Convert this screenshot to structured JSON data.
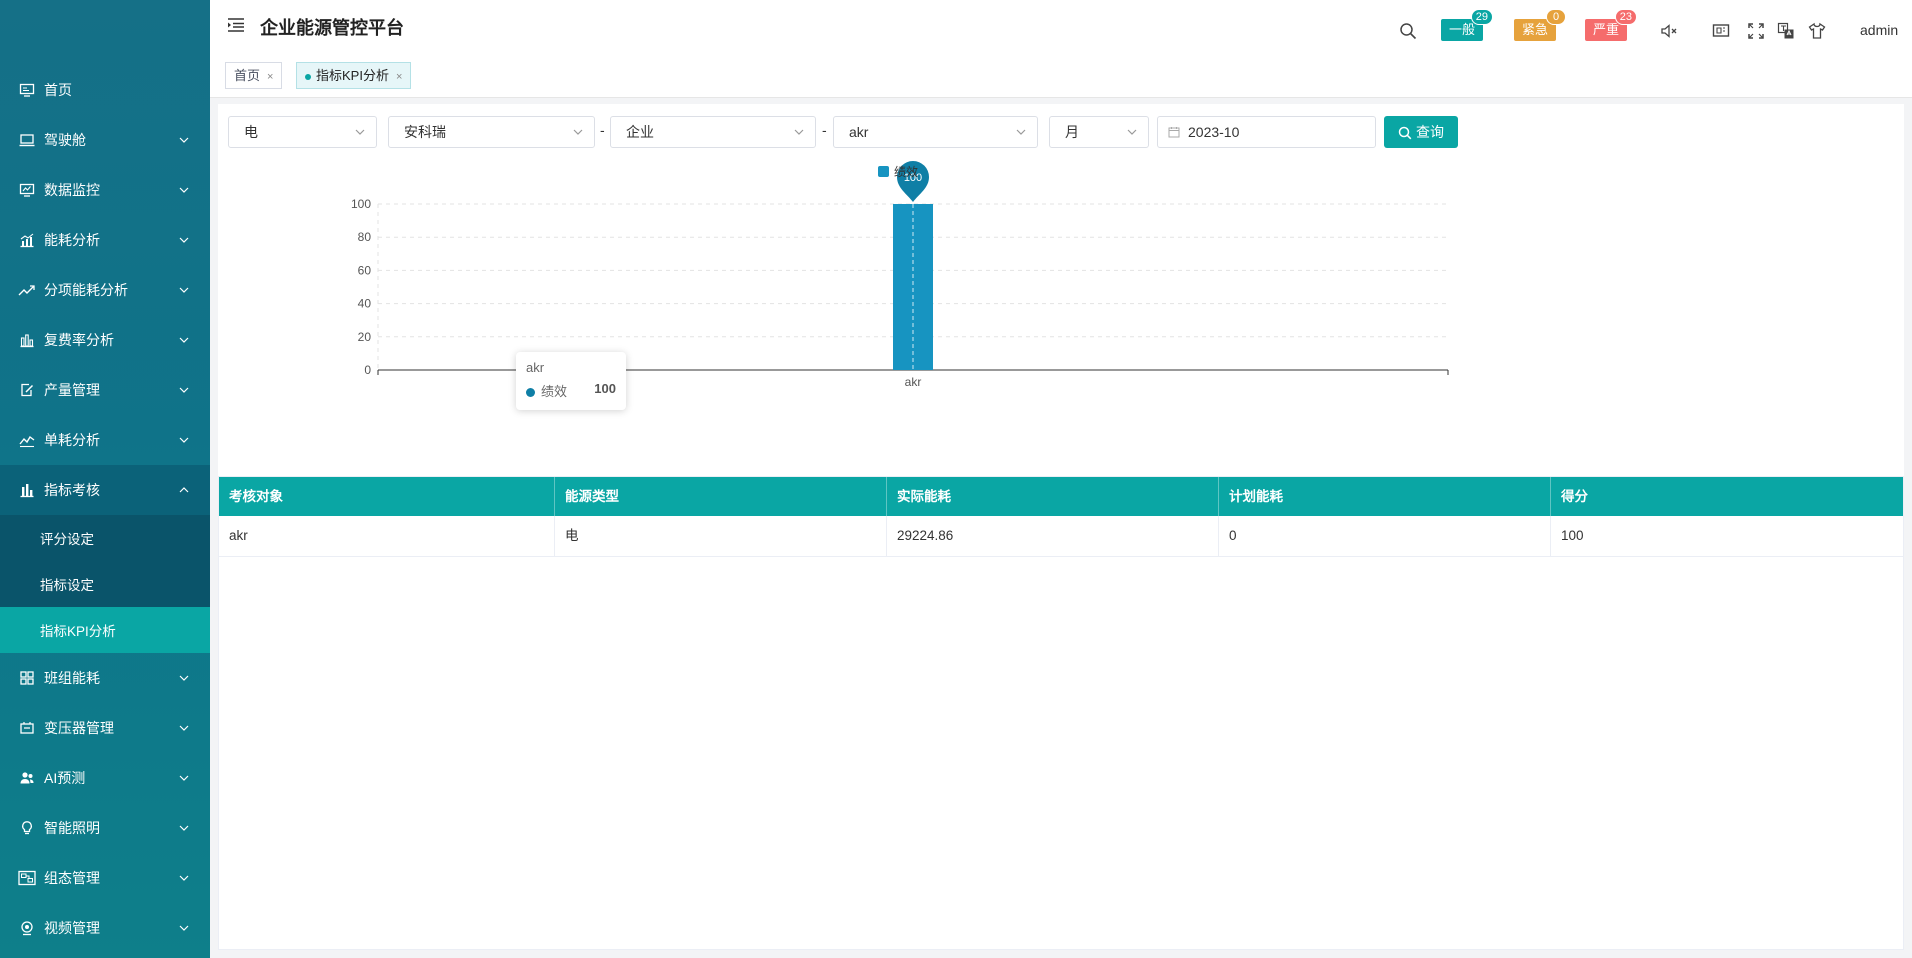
{
  "header": {
    "title": "企业能源管控平台",
    "user": "admin"
  },
  "alarms": [
    {
      "label": "一般",
      "count": "29",
      "color": "#0aa6a4"
    },
    {
      "label": "紧急",
      "count": "0",
      "color": "#e6a23c"
    },
    {
      "label": "严重",
      "count": "23",
      "color": "#f56c6c"
    }
  ],
  "sidebar": {
    "items": [
      {
        "label": "首页"
      },
      {
        "label": "驾驶舱"
      },
      {
        "label": "数据监控"
      },
      {
        "label": "能耗分析"
      },
      {
        "label": "分项能耗分析"
      },
      {
        "label": "复费率分析"
      },
      {
        "label": "产量管理"
      },
      {
        "label": "单耗分析"
      },
      {
        "label": "指标考核",
        "children": [
          {
            "label": "评分设定"
          },
          {
            "label": "指标设定"
          },
          {
            "label": "指标KPI分析"
          }
        ]
      },
      {
        "label": "班组能耗"
      },
      {
        "label": "变压器管理"
      },
      {
        "label": "AI预测"
      },
      {
        "label": "智能照明"
      },
      {
        "label": "组态管理"
      },
      {
        "label": "视频管理"
      }
    ]
  },
  "tabs": [
    {
      "label": "首页",
      "close": "×"
    },
    {
      "label": "指标KPI分析",
      "close": "×"
    }
  ],
  "filters": {
    "energy": "电",
    "site": "安科瑞",
    "sep": "-",
    "level": "企业",
    "object": "akr",
    "period": "月",
    "date": "2023-10",
    "query_label": "查询"
  },
  "chart_data": {
    "type": "bar",
    "categories": [
      "akr"
    ],
    "series": [
      {
        "name": "绩效",
        "values": [
          100
        ]
      }
    ],
    "ylim": [
      0,
      100
    ],
    "yticks": [
      0,
      20,
      40,
      60,
      80,
      100
    ],
    "legend": "top-center",
    "grid": true,
    "color": "#1794c1",
    "markpoint_label": "100",
    "tooltip": {
      "title": "akr",
      "series": "绩效",
      "value": "100"
    }
  },
  "table": {
    "columns": [
      "考核对象",
      "能源类型",
      "实际能耗",
      "计划能耗",
      "得分"
    ],
    "rows": [
      [
        "akr",
        "电",
        "29224.86",
        "0",
        "100"
      ]
    ]
  }
}
